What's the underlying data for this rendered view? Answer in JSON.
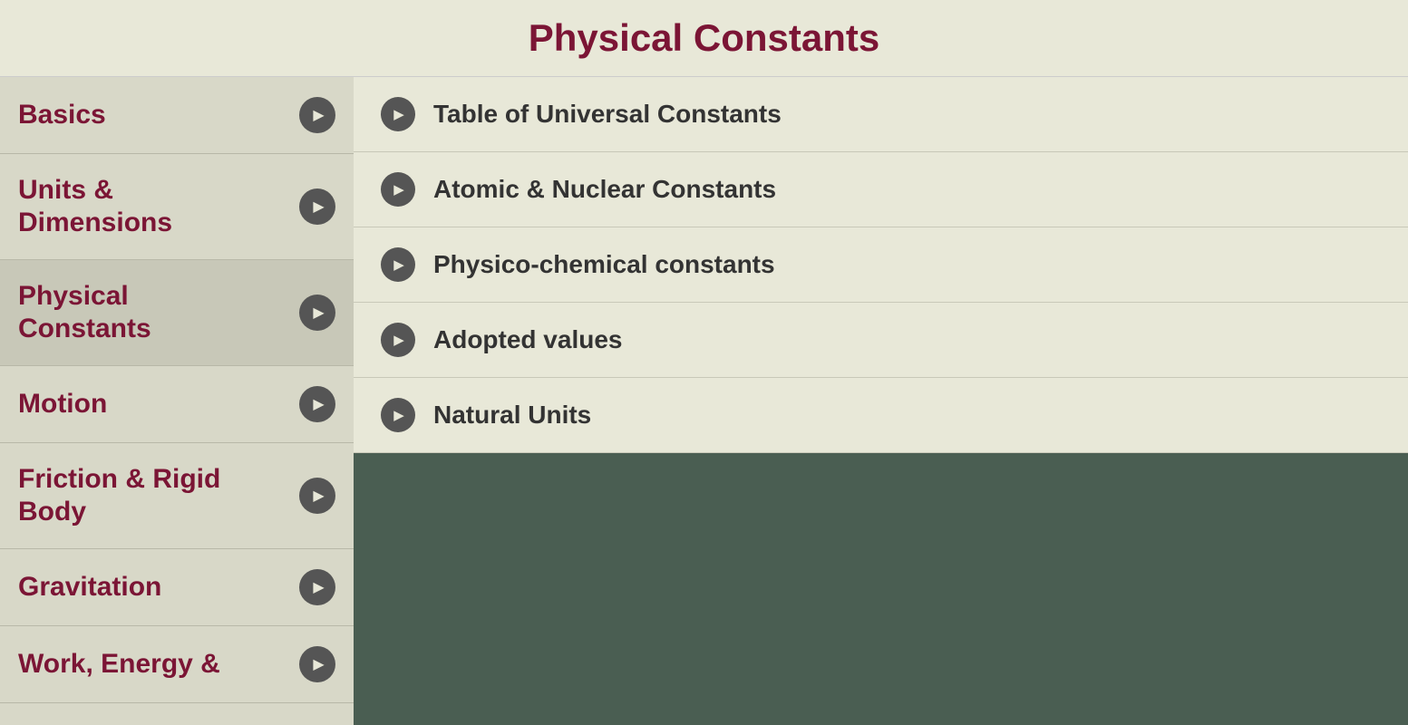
{
  "header": {
    "title": "Physical Constants"
  },
  "sidebar": {
    "items": [
      {
        "id": "basics",
        "label": "Basics",
        "active": false
      },
      {
        "id": "units-dimensions",
        "label": "Units &\nDimensions",
        "active": false
      },
      {
        "id": "physical-constants",
        "label": "Physical\nConstants",
        "active": true
      },
      {
        "id": "motion",
        "label": "Motion",
        "active": false
      },
      {
        "id": "friction-rigid-body",
        "label": "Friction & Rigid\nBody",
        "active": false
      },
      {
        "id": "gravitation",
        "label": "Gravitation",
        "active": false
      },
      {
        "id": "work-energy",
        "label": "Work, Energy &",
        "active": false
      }
    ]
  },
  "content": {
    "items": [
      {
        "id": "table-universal",
        "label": "Table of Universal Constants"
      },
      {
        "id": "atomic-nuclear",
        "label": "Atomic & Nuclear Constants"
      },
      {
        "id": "physico-chemical",
        "label": "Physico-chemical constants"
      },
      {
        "id": "adopted-values",
        "label": "Adopted values"
      },
      {
        "id": "natural-units",
        "label": "Natural Units"
      }
    ]
  }
}
